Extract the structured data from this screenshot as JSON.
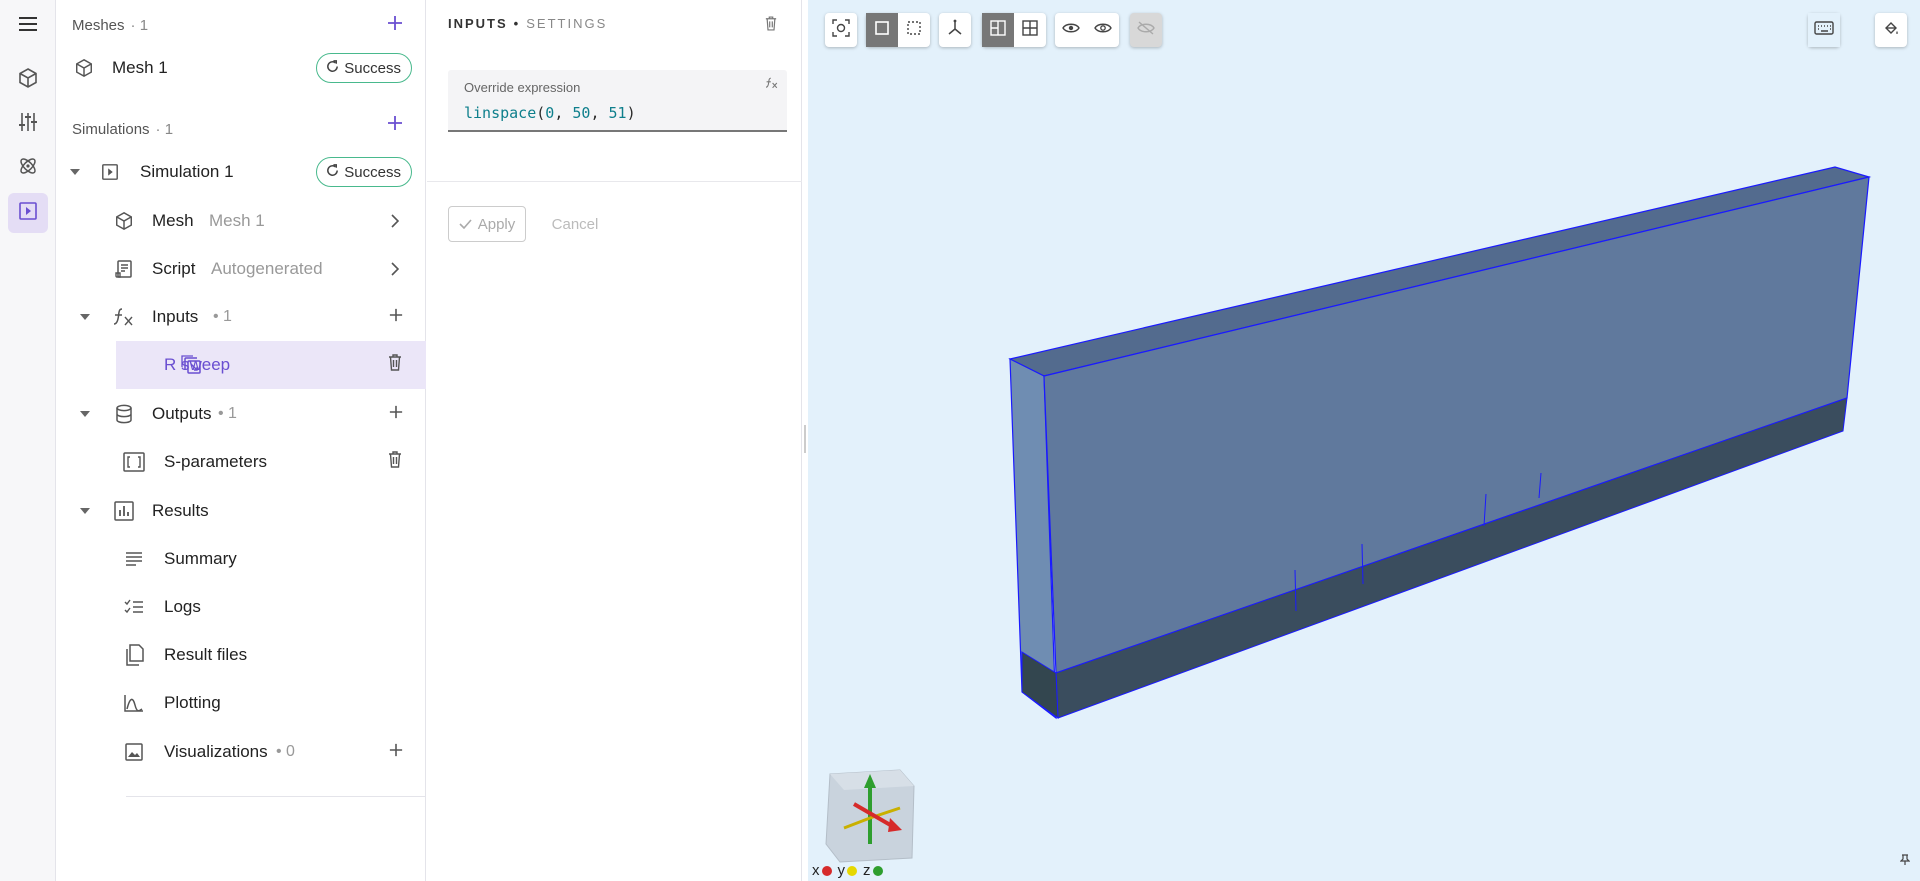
{
  "rail": {
    "items": [
      {
        "icon": "menu-icon"
      },
      {
        "icon": "cube-icon"
      },
      {
        "icon": "sliders-icon"
      },
      {
        "icon": "atom-icon"
      },
      {
        "icon": "play-box-icon",
        "active": true
      }
    ]
  },
  "tree": {
    "meshes": {
      "label": "Meshes",
      "count": "·  1",
      "item": {
        "label": "Mesh 1",
        "status": "Success"
      }
    },
    "simulations": {
      "label": "Simulations",
      "count": "·  1"
    },
    "simulation": {
      "label": "Simulation 1",
      "status": "Success"
    },
    "mesh_row": {
      "label": "Mesh",
      "value": "Mesh 1"
    },
    "script_row": {
      "label": "Script",
      "value": "Autogenerated"
    },
    "inputs": {
      "label": "Inputs",
      "count": "• 1",
      "child": "R sweep"
    },
    "outputs": {
      "label": "Outputs",
      "count": "• 1",
      "child": "S-parameters"
    },
    "results": {
      "label": "Results",
      "items": [
        "Summary",
        "Logs",
        "Result files",
        "Plotting"
      ],
      "visualizations": {
        "label": "Visualizations",
        "count": "• 0"
      }
    }
  },
  "settings": {
    "title_main": "INPUTS",
    "title_sep": "•",
    "title_sub": "SETTINGS",
    "field_caption": "Override expression",
    "expr_fn": "linspace",
    "expr_open": "(",
    "expr_a": "0",
    "expr_sep1": ", ",
    "expr_b": "50",
    "expr_sep2": ", ",
    "expr_c": "51",
    "expr_close": ")",
    "apply_label": "Apply",
    "cancel_label": "Cancel"
  },
  "viewport": {
    "axes": {
      "x": "x",
      "y": "y",
      "z": "z"
    },
    "colors": {
      "box_face": "#5f7ea3",
      "box_edge": "#1a1aff",
      "background": "#e3f1fb",
      "accent": "#6a4fd1",
      "success": "#49b98d"
    }
  }
}
